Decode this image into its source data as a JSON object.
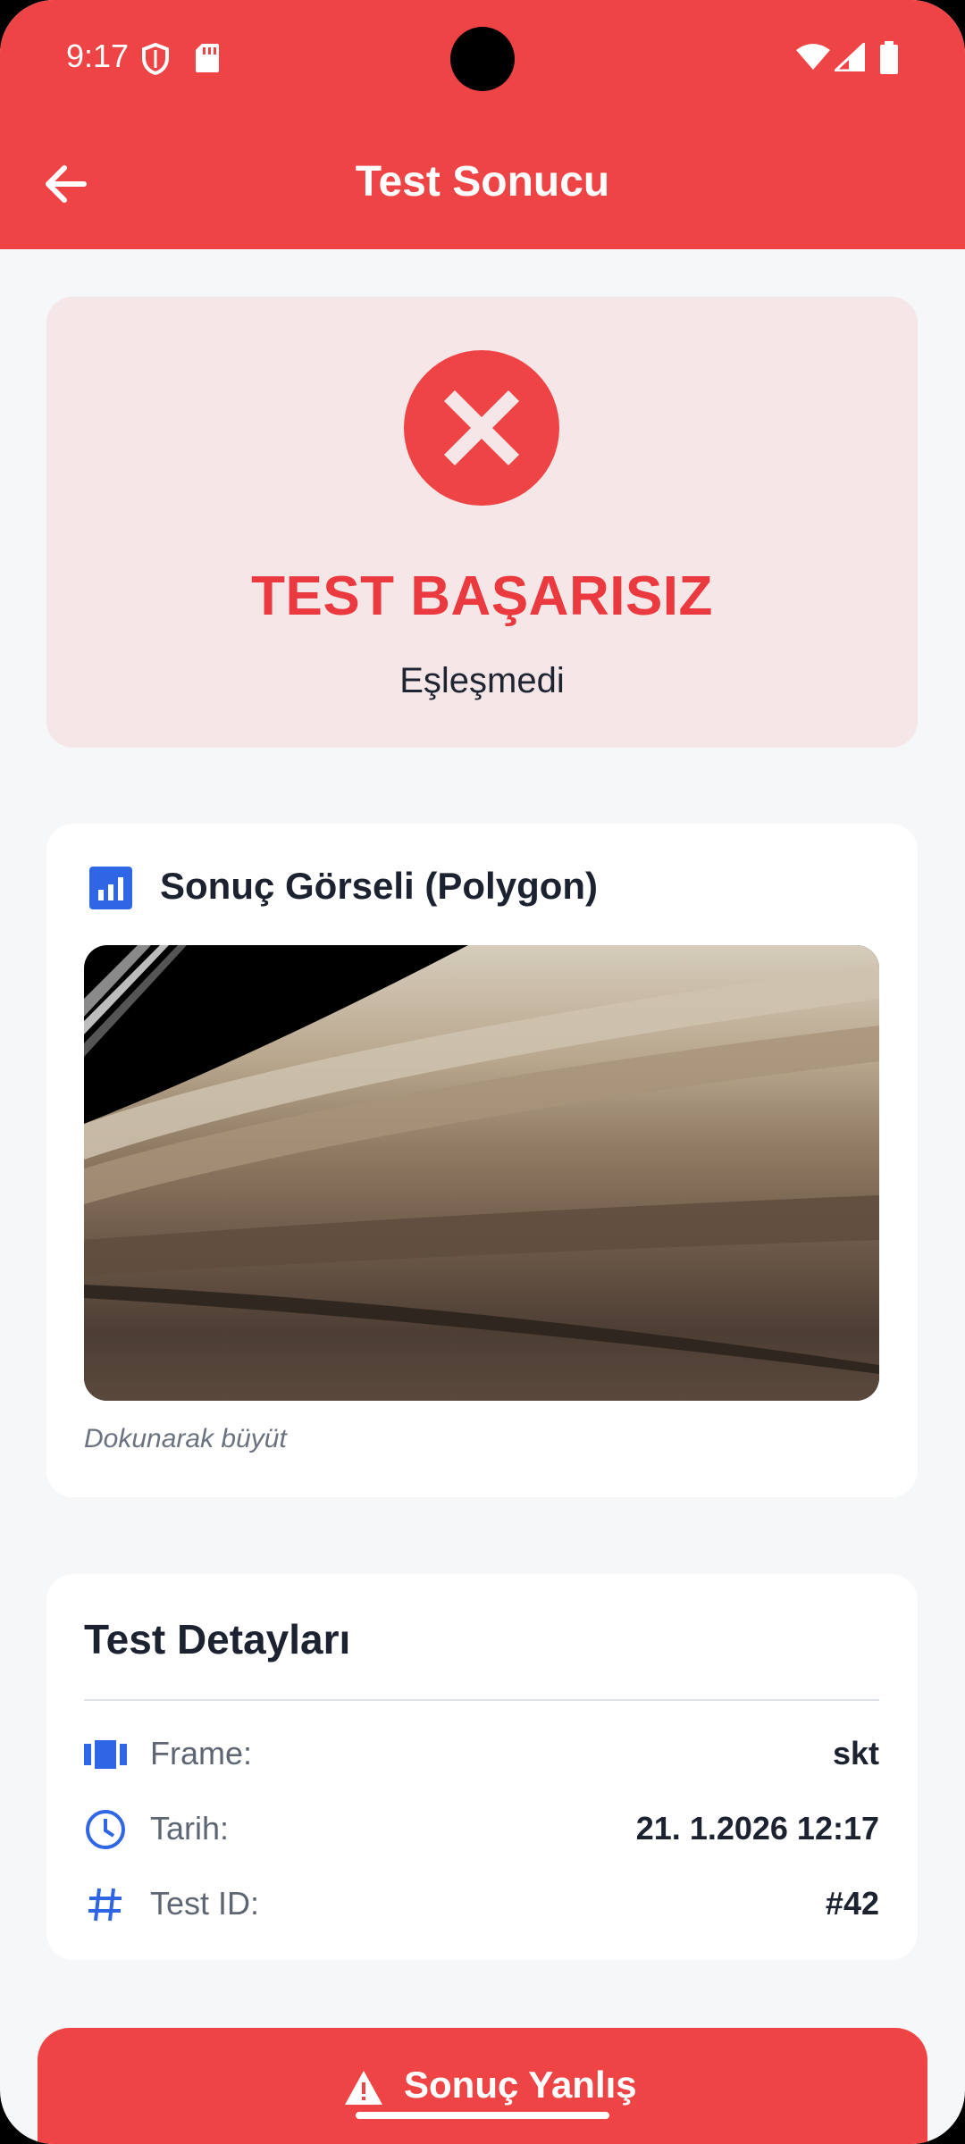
{
  "status_bar": {
    "time": "9:17"
  },
  "app_bar": {
    "title": "Test Sonucu"
  },
  "result": {
    "title": "TEST BAŞARISIZ",
    "subtitle": "Eşleşmedi"
  },
  "image_card": {
    "title": "Sonuç Görseli (Polygon)",
    "hint": "Dokunarak büyüt"
  },
  "details": {
    "title": "Test Detayları",
    "rows": [
      {
        "label": "Frame:",
        "value": "skt",
        "icon": "film-icon"
      },
      {
        "label": "Tarih:",
        "value": "21. 1.2026 12:17",
        "icon": "clock-icon"
      },
      {
        "label": "Test ID:",
        "value": "#42",
        "icon": "hash-icon"
      }
    ]
  },
  "bottom_button": {
    "label": "Sonuç Yanlış",
    "icon": "warning-icon"
  },
  "colors": {
    "primary": "#ef4446",
    "result_bg": "#f5e6e8",
    "accent_blue": "#2f66e6"
  }
}
